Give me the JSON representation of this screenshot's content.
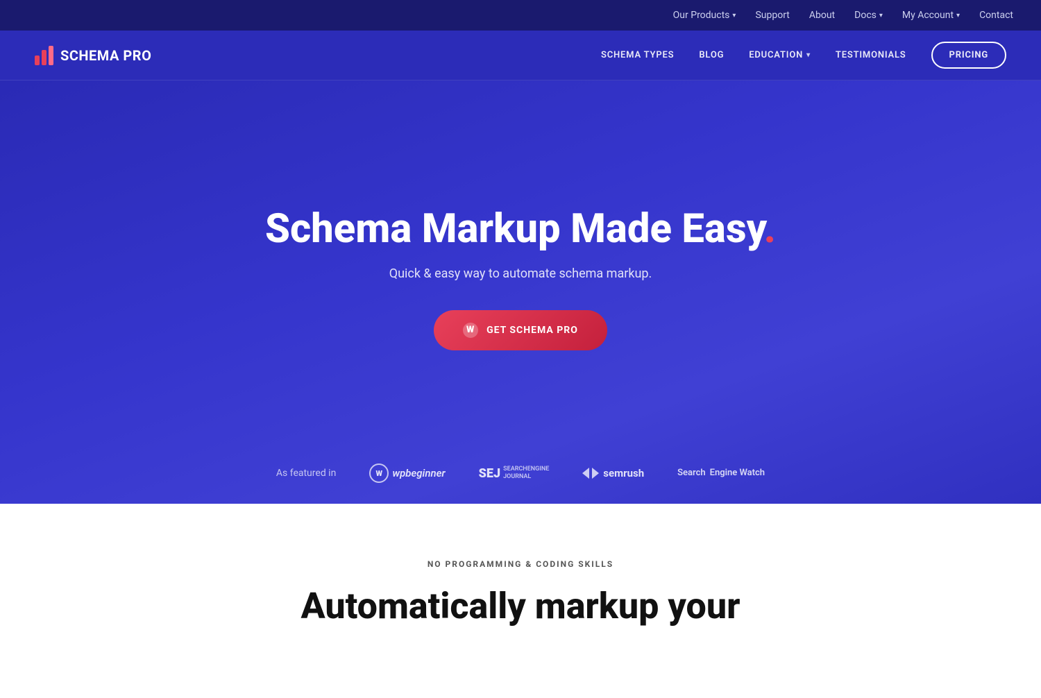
{
  "topbar": {
    "links": [
      {
        "label": "Our Products",
        "hasDropdown": true
      },
      {
        "label": "Support",
        "hasDropdown": false
      },
      {
        "label": "About",
        "hasDropdown": false
      },
      {
        "label": "Docs",
        "hasDropdown": true
      },
      {
        "label": "My Account",
        "hasDropdown": true
      },
      {
        "label": "Contact",
        "hasDropdown": false
      }
    ]
  },
  "nav": {
    "logo_text": "SCHEMA PRO",
    "links": [
      {
        "label": "SCHEMA TYPES",
        "hasDropdown": false
      },
      {
        "label": "BLOG",
        "hasDropdown": false
      },
      {
        "label": "EDUCATION",
        "hasDropdown": true
      },
      {
        "label": "TESTIMONIALS",
        "hasDropdown": false
      }
    ],
    "pricing_label": "PRICING"
  },
  "hero": {
    "title_main": "Schema Markup Made Easy",
    "title_dot": ".",
    "subtitle": "Quick & easy way to automate schema markup.",
    "cta_label": "GET SCHEMA PRO",
    "featured_label": "As featured in",
    "featured_logos": [
      {
        "name": "wpbeginner",
        "display": "wpbeginner"
      },
      {
        "name": "sej",
        "display": "SEJ Search Engine Journal"
      },
      {
        "name": "semrush",
        "display": "semrush"
      },
      {
        "name": "sewatch",
        "display": "Search Engine Watch"
      }
    ]
  },
  "bottom": {
    "eyebrow": "NO PROGRAMMING & CODING SKILLS",
    "title": "Automatically markup your"
  }
}
